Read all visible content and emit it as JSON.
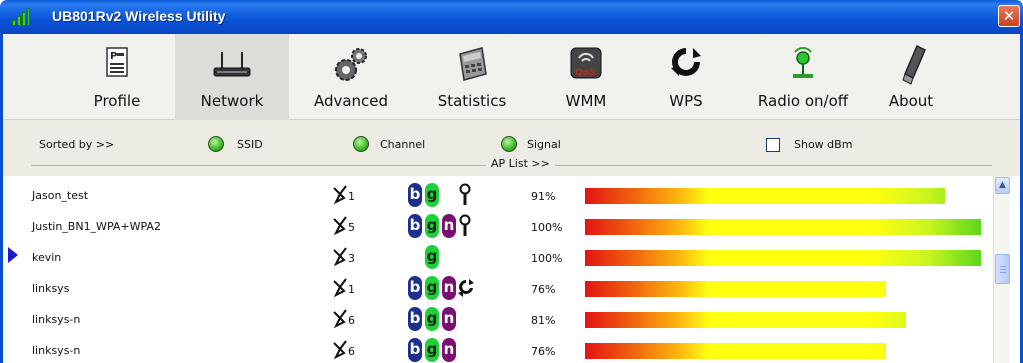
{
  "window": {
    "title": "UB801Rv2 Wireless Utility",
    "close_glyph": "✕"
  },
  "toolbar": {
    "items": [
      {
        "label": "Profile",
        "icon": "profile-icon",
        "selected": false
      },
      {
        "label": "Network",
        "icon": "router-icon",
        "selected": true
      },
      {
        "label": "Advanced",
        "icon": "gears-icon",
        "selected": false
      },
      {
        "label": "Statistics",
        "icon": "calculator-icon",
        "selected": false
      },
      {
        "label": "WMM",
        "icon": "qos-icon",
        "selected": false
      },
      {
        "label": "WPS",
        "icon": "wps-icon",
        "selected": false
      },
      {
        "label": "Radio on/off",
        "icon": "radio-antenna-icon",
        "selected": false
      },
      {
        "label": "About",
        "icon": "usb-adapter-icon",
        "selected": false
      }
    ]
  },
  "sort": {
    "label": "Sorted by >>",
    "options": [
      "SSID",
      "Channel",
      "Signal"
    ],
    "show_dbm_label": "Show dBm",
    "show_dbm_checked": false,
    "ap_list_label": "AP List >>"
  },
  "ap_list": [
    {
      "ssid": "Jason_test",
      "channel": "1",
      "modes": [
        "b",
        "g"
      ],
      "security": "lock",
      "signal": "91%",
      "signal_value": 91,
      "current": false
    },
    {
      "ssid": "Justin_BN1_WPA+WPA2",
      "channel": "5",
      "modes": [
        "b",
        "g",
        "n"
      ],
      "security": "lock",
      "signal": "100%",
      "signal_value": 100,
      "current": false
    },
    {
      "ssid": "kevin",
      "channel": "3",
      "modes": [
        "g"
      ],
      "security": "",
      "signal": "100%",
      "signal_value": 100,
      "current": true
    },
    {
      "ssid": "linksys",
      "channel": "1",
      "modes": [
        "b",
        "g",
        "n"
      ],
      "security": "wps",
      "signal": "76%",
      "signal_value": 76,
      "current": false
    },
    {
      "ssid": "linksys-n",
      "channel": "6",
      "modes": [
        "b",
        "g",
        "n"
      ],
      "security": "",
      "signal": "81%",
      "signal_value": 81,
      "current": false
    },
    {
      "ssid": "linksys-n",
      "channel": "6",
      "modes": [
        "b",
        "g",
        "n"
      ],
      "security": "",
      "signal": "76%",
      "signal_value": 76,
      "current": false
    }
  ],
  "scrollbar": {
    "up_glyph": "▲"
  },
  "colors": {
    "title_bar": "#0b55d8",
    "mode_b": "#1e2f8f",
    "mode_g": "#1fcf3c",
    "mode_n": "#7a0f72",
    "radio_green": "#3fbf2c",
    "current_marker": "#1a1ad0"
  }
}
